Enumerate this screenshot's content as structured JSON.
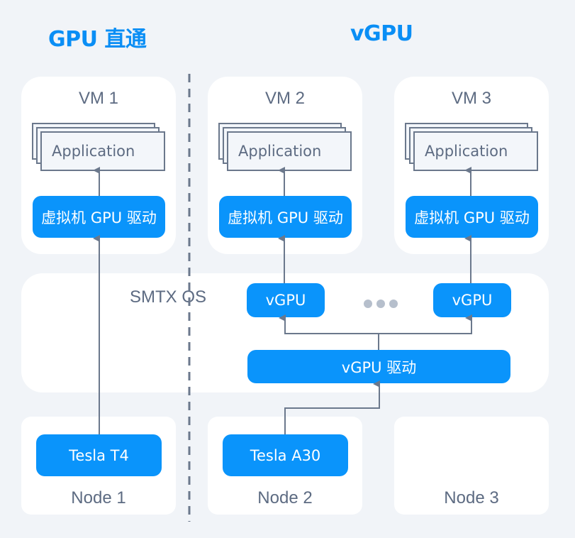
{
  "headers": {
    "passthrough": "GPU 直通",
    "vgpu": "vGPU"
  },
  "vms": [
    {
      "name": "VM 1",
      "app": "Application",
      "driver": "虚拟机 GPU 驱动"
    },
    {
      "name": "VM 2",
      "app": "Application",
      "driver": "虚拟机 GPU 驱动"
    },
    {
      "name": "VM 3",
      "app": "Application",
      "driver": "虚拟机 GPU 驱动"
    }
  ],
  "os": {
    "name": "SMTX OS",
    "vgpu_instances": [
      "vGPU",
      "vGPU"
    ],
    "vgpu_driver": "vGPU 驱动"
  },
  "nodes": [
    {
      "name": "Node 1",
      "gpu": "Tesla T4"
    },
    {
      "name": "Node 2",
      "gpu": "Tesla A30"
    },
    {
      "name": "Node 3",
      "gpu": ""
    }
  ],
  "colors": {
    "accent": "#0a94fb",
    "title": "#0a8ef5",
    "line": "#6b788c",
    "text": "#5d6b82",
    "background": "#f1f4f8"
  }
}
